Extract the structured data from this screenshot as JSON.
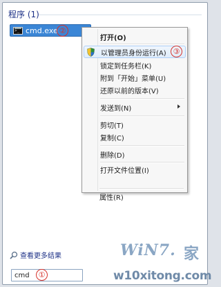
{
  "programs_header": "程序 (1)",
  "result": {
    "label": "cmd.exe"
  },
  "markers": [
    "①",
    "②",
    "③"
  ],
  "context_menu": {
    "items": [
      {
        "label": "打开(O)",
        "bold": true
      },
      {
        "label": "以管理员身份运行(A)",
        "highlight": true,
        "icon": "uac-shield-icon"
      },
      {
        "label": "锁定到任务栏(K)"
      },
      {
        "label": "附到「开始」菜单(U)"
      },
      {
        "label": "还原以前的版本(V)"
      },
      {
        "label": "发送到(N)",
        "submenu": true
      },
      {
        "label": "剪切(T)"
      },
      {
        "label": "复制(C)"
      },
      {
        "label": "删除(D)"
      },
      {
        "label": "打开文件位置(I)"
      },
      {
        "label": "属性(R)"
      }
    ]
  },
  "more_results": "查看更多结果",
  "search": {
    "value": "cmd"
  },
  "logo": {
    "text": "WiN7.",
    "suffix": "家"
  },
  "watermark": "w10xitong.com",
  "colors": {
    "selection": "#3b86d6",
    "marker": "#d6322b",
    "header_text": "#1e3287"
  }
}
